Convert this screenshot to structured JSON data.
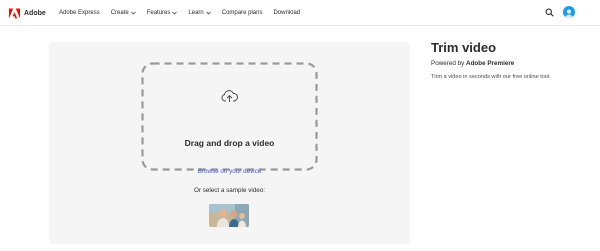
{
  "header": {
    "brand": "Adobe",
    "brand_color": "#eb1000",
    "nav": [
      {
        "label": "Adobe Express",
        "dropdown": false
      },
      {
        "label": "Create",
        "dropdown": true
      },
      {
        "label": "Features",
        "dropdown": true
      },
      {
        "label": "Learn",
        "dropdown": true
      },
      {
        "label": "Compare plans",
        "dropdown": false
      },
      {
        "label": "Download",
        "dropdown": false
      }
    ],
    "search_icon": "search-icon",
    "avatar_color": "#1a9bf0"
  },
  "upload": {
    "icon": "cloud-upload-icon",
    "drop_title": "Drag and drop a video",
    "browse_link": "Browse on your device",
    "sample_label": "Or select a sample video:",
    "link_color": "#4056d1"
  },
  "info": {
    "title": "Trim video",
    "powered_prefix": "Powered by",
    "powered_brand": "Adobe Premiere",
    "description": "Trim a video in seconds with our free online tool."
  }
}
